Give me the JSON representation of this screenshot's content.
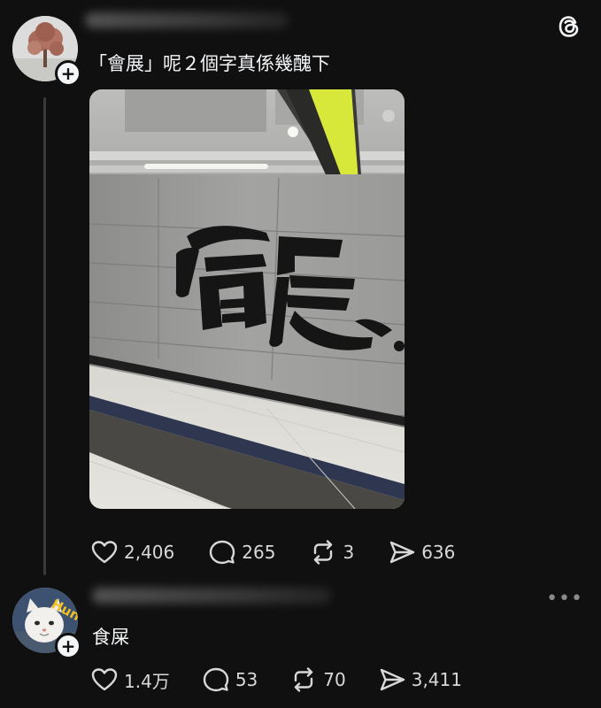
{
  "posts": [
    {
      "text": "「會展」呢２個字真係幾醜下",
      "photo_sign_text": "會展",
      "stats": {
        "likes": "2,406",
        "comments": "265",
        "reposts": "3",
        "shares": "636"
      }
    },
    {
      "text": "食屎",
      "avatar_badge_text": "Hun",
      "stats": {
        "likes": "1.4万",
        "comments": "53",
        "reposts": "70",
        "shares": "3,411"
      }
    }
  ],
  "icons": {
    "app_logo": "threads-logo-icon",
    "follow": "plus-icon",
    "like": "heart-icon",
    "comment": "comment-bubble-icon",
    "repost": "repost-icon",
    "share": "send-icon",
    "more": "more-icon"
  },
  "colors": {
    "background": "#101010",
    "text": "#f3f5f7",
    "muted": "#d8d8d8",
    "sign_yellow": "#d8e83a"
  }
}
